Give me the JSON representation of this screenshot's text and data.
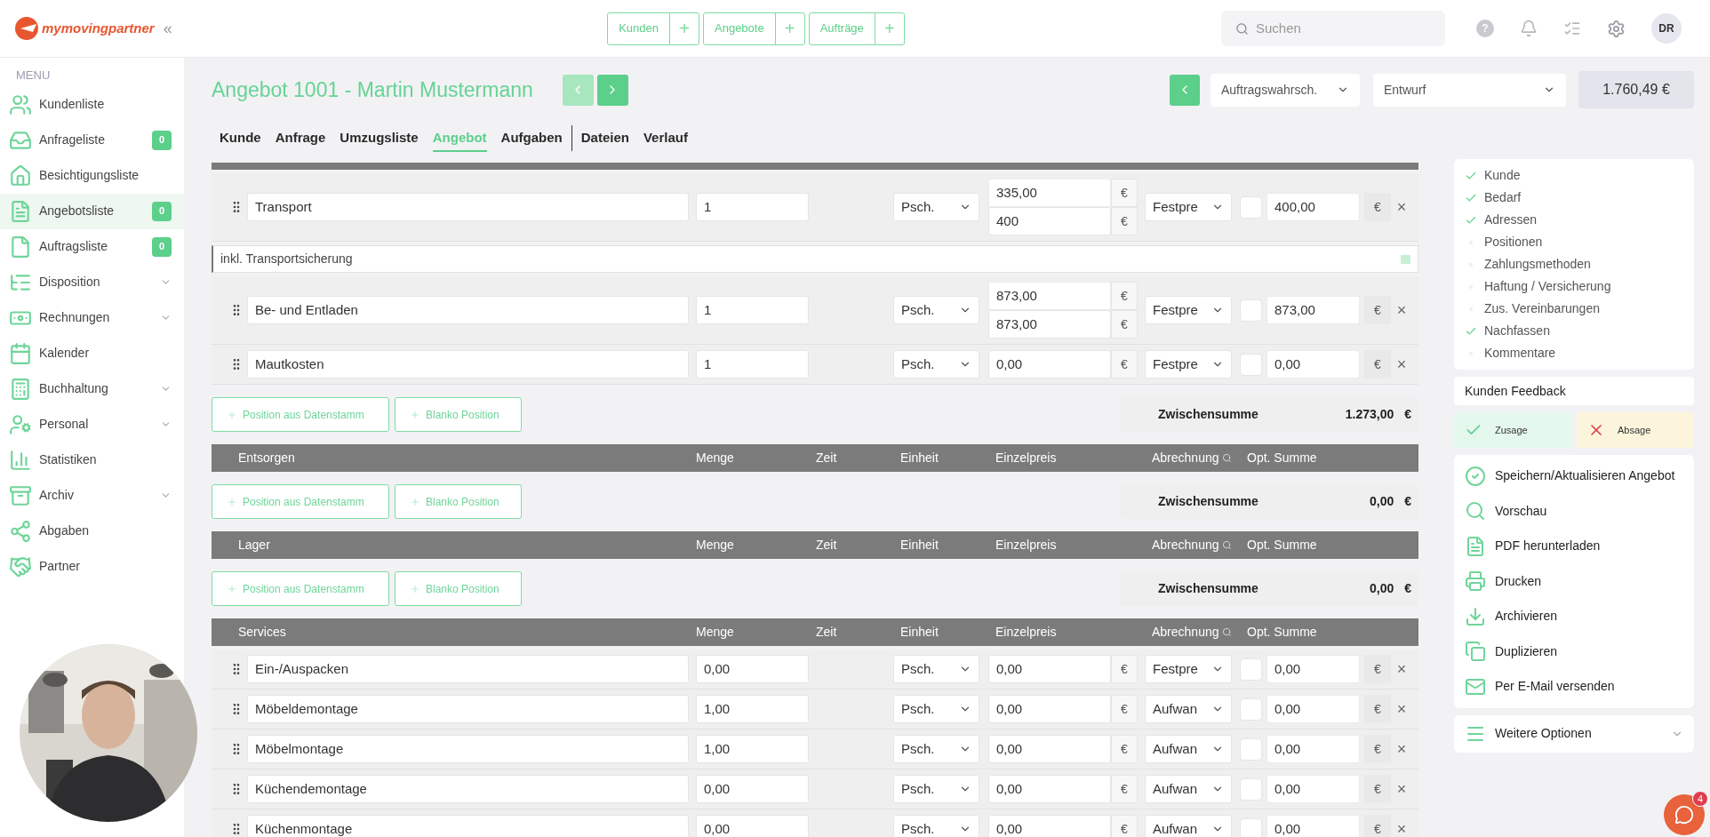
{
  "logo": {
    "text": "mymovingpartner"
  },
  "topbar": {
    "collapse": "«",
    "quick_tabs": [
      {
        "label": "Kunden",
        "add": "+"
      },
      {
        "label": "Angebote",
        "add": "+"
      },
      {
        "label": "Aufträge",
        "add": "+"
      }
    ],
    "search": {
      "placeholder": "Suchen"
    },
    "help": "?",
    "avatar": "DR"
  },
  "sidebar": {
    "heading": "MENU",
    "items": [
      {
        "label": "Kundenliste",
        "selected": false,
        "expandable": false
      },
      {
        "label": "Anfrageliste",
        "badge": "0",
        "selected": false,
        "expandable": false
      },
      {
        "label": "Besichtigungsliste",
        "selected": false,
        "expandable": false
      },
      {
        "label": "Angebotsliste",
        "badge": "0",
        "selected": true,
        "expandable": false
      },
      {
        "label": "Auftragsliste",
        "badge": "0",
        "selected": false,
        "expandable": false
      },
      {
        "label": "Disposition",
        "selected": false,
        "expandable": true
      },
      {
        "label": "Rechnungen",
        "selected": false,
        "expandable": true
      },
      {
        "label": "Kalender",
        "selected": false,
        "expandable": false
      },
      {
        "label": "Buchhaltung",
        "selected": false,
        "expandable": true
      },
      {
        "label": "Personal",
        "selected": false,
        "expandable": true
      },
      {
        "label": "Statistiken",
        "selected": false,
        "expandable": false
      },
      {
        "label": "Archiv",
        "selected": false,
        "expandable": true
      },
      {
        "label": "Abgaben",
        "selected": false,
        "expandable": false
      },
      {
        "label": "Partner",
        "selected": false,
        "expandable": false
      }
    ]
  },
  "header": {
    "title": "Angebot 1001 - Martin Mustermann",
    "nav": [
      {
        "kind": "prev",
        "disabled": true
      },
      {
        "kind": "next",
        "disabled": false
      }
    ],
    "probability": "Auftragswahrsch.",
    "status": "Entwurf",
    "total": "1.760,49 €"
  },
  "tabs": [
    {
      "label": "Kunde",
      "selected": false,
      "separator": false
    },
    {
      "label": "Anfrage",
      "selected": false,
      "separator": false
    },
    {
      "label": "Umzugsliste",
      "selected": false,
      "separator": false
    },
    {
      "label": "Angebot",
      "selected": true,
      "separator": false
    },
    {
      "label": "Aufgaben",
      "selected": false,
      "separator": false
    },
    {
      "label": "Dateien",
      "selected": false,
      "separator": true
    },
    {
      "label": "Verlauf",
      "selected": false,
      "separator": false
    }
  ],
  "sections": [
    {
      "rows": [
        {
          "kind": "position",
          "name": "Transport",
          "quantity": "1",
          "unit": "Psch.",
          "prices": [
            {
              "value": "335,00",
              "currency": "€"
            },
            {
              "value": "400",
              "currency": "€"
            }
          ],
          "billing": "Festpre",
          "optional": false,
          "sum": "400,00",
          "currency": "€",
          "remove": "×"
        },
        {
          "kind": "note",
          "text": "inkl. Transportsicherung"
        },
        {
          "kind": "position",
          "name": "Be- und Entladen",
          "quantity": "1",
          "unit": "Psch.",
          "prices": [
            {
              "value": "873,00",
              "currency": "€"
            },
            {
              "value": "873,00",
              "currency": "€"
            }
          ],
          "billing": "Festpre",
          "optional": false,
          "sum": "873,00",
          "currency": "€",
          "remove": "×"
        },
        {
          "kind": "position",
          "name": "Mautkosten",
          "quantity": "1",
          "unit": "Psch.",
          "prices": [
            {
              "value": "0,00",
              "currency": "€"
            }
          ],
          "billing": "Festpre",
          "optional": false,
          "sum": "0,00",
          "currency": "€",
          "remove": "×"
        }
      ],
      "actions": [
        "Position aus Datenstamm",
        "Blanko Position"
      ],
      "subtotal": {
        "label": "Zwischensumme",
        "value": "1.273,00",
        "currency": "€"
      }
    },
    {
      "title": "Entsorgen",
      "columns": [
        "Menge",
        "Zeit",
        "Einheit",
        "Einzelpreis",
        "Abrechnung",
        "Opt. Summe"
      ],
      "actions": [
        "Position aus Datenstamm",
        "Blanko Position"
      ],
      "subtotal": {
        "label": "Zwischensumme",
        "value": "0,00",
        "currency": "€"
      }
    },
    {
      "title": "Lager",
      "columns": [
        "Menge",
        "Zeit",
        "Einheit",
        "Einzelpreis",
        "Abrechnung",
        "Opt. Summe"
      ],
      "actions": [
        "Position aus Datenstamm",
        "Blanko Position"
      ],
      "subtotal": {
        "label": "Zwischensumme",
        "value": "0,00",
        "currency": "€"
      }
    },
    {
      "title": "Services",
      "columns": [
        "Menge",
        "Zeit",
        "Einheit",
        "Einzelpreis",
        "Abrechnung",
        "Opt. Summe"
      ],
      "rows": [
        {
          "kind": "position",
          "name": "Ein-/Auspacken",
          "quantity": "0,00",
          "unit": "Psch.",
          "prices": [
            {
              "value": "0,00",
              "currency": "€"
            }
          ],
          "billing": "Festpre",
          "optional": false,
          "sum": "0,00",
          "currency": "€",
          "remove": "×"
        },
        {
          "kind": "position",
          "name": "Möbeldemontage",
          "quantity": "1,00",
          "unit": "Psch.",
          "prices": [
            {
              "value": "0,00",
              "currency": "€"
            }
          ],
          "billing": "Aufwan",
          "optional": false,
          "sum": "0,00",
          "currency": "€",
          "remove": "×"
        },
        {
          "kind": "position",
          "name": "Möbelmontage",
          "quantity": "1,00",
          "unit": "Psch.",
          "prices": [
            {
              "value": "0,00",
              "currency": "€"
            }
          ],
          "billing": "Aufwan",
          "optional": false,
          "sum": "0,00",
          "currency": "€",
          "remove": "×"
        },
        {
          "kind": "position",
          "name": "Küchendemontage",
          "quantity": "0,00",
          "unit": "Psch.",
          "prices": [
            {
              "value": "0,00",
              "currency": "€"
            }
          ],
          "billing": "Aufwan",
          "optional": false,
          "sum": "0,00",
          "currency": "€",
          "remove": "×"
        },
        {
          "kind": "position",
          "name": "Küchenmontage",
          "quantity": "0,00",
          "unit": "Psch.",
          "prices": [
            {
              "value": "0,00",
              "currency": "€"
            }
          ],
          "billing": "Aufwan",
          "optional": false,
          "sum": "0,00",
          "currency": "€",
          "remove": "×"
        }
      ]
    }
  ],
  "checklist": [
    {
      "label": "Kunde",
      "checked": true
    },
    {
      "label": "Bedarf",
      "checked": true
    },
    {
      "label": "Adressen",
      "checked": true
    },
    {
      "label": "Positionen",
      "checked": false
    },
    {
      "label": "Zahlungsmethoden",
      "checked": false
    },
    {
      "label": "Haftung / Versicherung",
      "checked": false
    },
    {
      "label": "Zus. Vereinbarungen",
      "checked": false
    },
    {
      "label": "Nachfassen",
      "checked": true
    },
    {
      "label": "Kommentare",
      "checked": false
    }
  ],
  "feedback": {
    "title": "Kunden Feedback",
    "buttons": [
      {
        "kind": "accept",
        "label": "Zusage"
      },
      {
        "kind": "reject",
        "label": "Absage"
      }
    ]
  },
  "actions": [
    "Speichern/Aktualisieren Angebot",
    "Vorschau",
    "PDF herunterladen",
    "Drucken",
    "Archivieren",
    "Duplizieren",
    "Per E-Mail versenden"
  ],
  "more": "Weitere Optionen",
  "chat_badge": "4"
}
